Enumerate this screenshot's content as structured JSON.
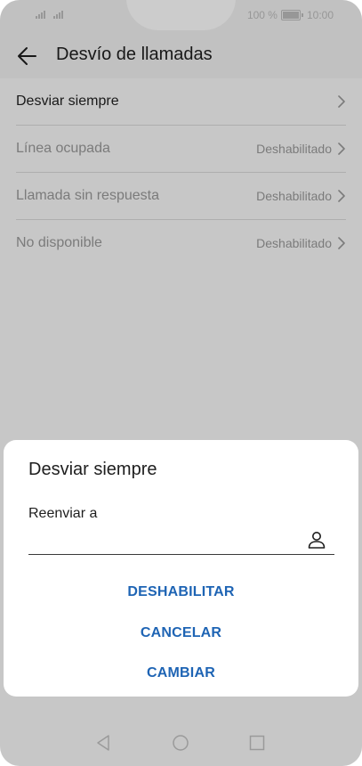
{
  "status_bar": {
    "signal_icons": [
      "signal-icon",
      "signal-icon"
    ],
    "battery_text": "100 %",
    "time": "10:00"
  },
  "header": {
    "back_icon": "arrow-left-icon",
    "title": "Desvío de llamadas"
  },
  "list": {
    "items": [
      {
        "label": "Desviar siempre",
        "status": ""
      },
      {
        "label": "Línea ocupada",
        "status": "Deshabilitado"
      },
      {
        "label": "Llamada sin respuesta",
        "status": "Deshabilitado"
      },
      {
        "label": "No disponible",
        "status": "Deshabilitado"
      }
    ]
  },
  "dialog": {
    "title": "Desviar siempre",
    "field_label": "Reenviar a",
    "field_value": "",
    "contact_icon": "contact-person-icon",
    "buttons": {
      "disable": "DESHABILITAR",
      "cancel": "CANCELAR",
      "change": "CAMBIAR"
    }
  },
  "nav_bar": {
    "icons": [
      "triangle-back-icon",
      "circle-home-icon",
      "square-recents-icon"
    ]
  },
  "colors": {
    "accent": "#1e64b4",
    "disabled_text": "#9a9a9a",
    "overlay": "#000000"
  }
}
